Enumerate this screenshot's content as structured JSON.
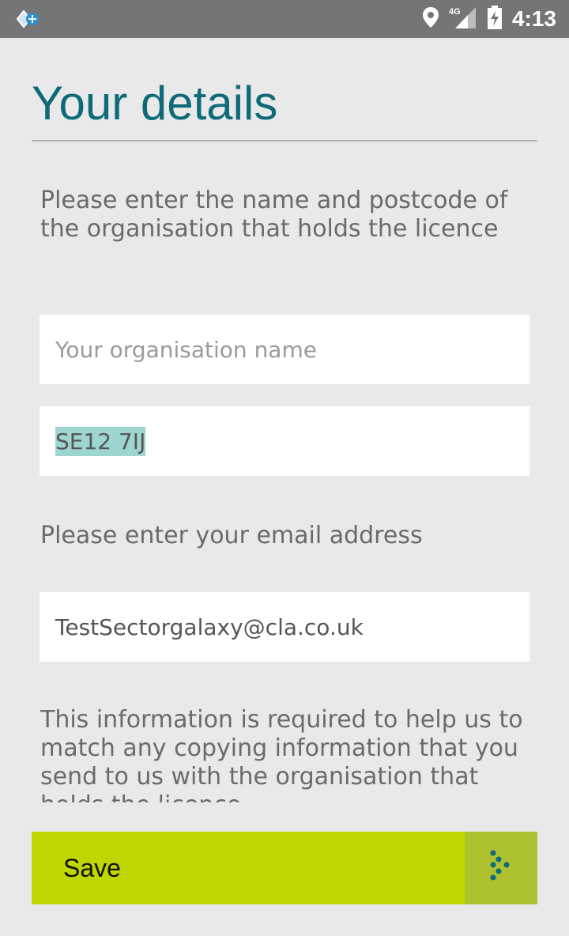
{
  "status_bar": {
    "time": "4:13",
    "network": "4G",
    "icons": [
      "app-icon",
      "location-icon",
      "signal-icon",
      "battery-charging-icon"
    ]
  },
  "page": {
    "title": "Your details",
    "org_instruction": "Please enter the name and postcode of the organisation that holds the licence",
    "email_instruction": "Please enter your email address",
    "info_text": "This information is required to help us to match any copying information that you send to us with the organisation that holds the licence"
  },
  "form": {
    "org_name": {
      "value": "",
      "placeholder": "Your organisation name"
    },
    "postcode": {
      "value": "SE12 7IJ"
    },
    "email": {
      "value": "TestSectorgalaxy@cla.co.uk"
    }
  },
  "save_button": {
    "label": "Save",
    "icon": "dotted-arrow-icon",
    "color": "#bfd600",
    "accent": "#adc12f"
  },
  "colors": {
    "title": "#0e6a78",
    "background": "#e9e9e9",
    "status_bar": "#757575",
    "selection": "#9dd5d1"
  }
}
